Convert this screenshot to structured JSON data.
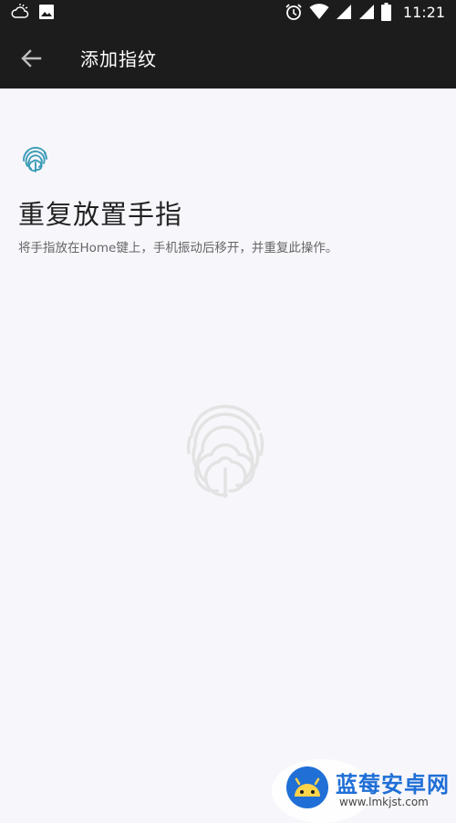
{
  "status_bar": {
    "time": "11:21",
    "left_icons": [
      "weather-icon",
      "image-notification-icon"
    ],
    "right_icons": [
      "alarm-icon",
      "wifi-icon",
      "signal-icon",
      "signal-icon-2",
      "battery-icon"
    ]
  },
  "app_bar": {
    "title": "添加指纹",
    "back_icon": "arrow-left-icon"
  },
  "main": {
    "heading": "重复放置手指",
    "instruction": "将手指放在Home键上，手机振动后移开，并重复此操作。"
  },
  "watermark": {
    "name": "蓝莓安卓网",
    "url": "www.lmkjst.com"
  },
  "colors": {
    "bar_background": "#1c1c1c",
    "page_background": "#f7f6fa",
    "fingerprint_accent": "#3a9cb8",
    "fingerprint_placeholder": "#e3e3e3",
    "watermark_blue": "#1f6fd6"
  }
}
